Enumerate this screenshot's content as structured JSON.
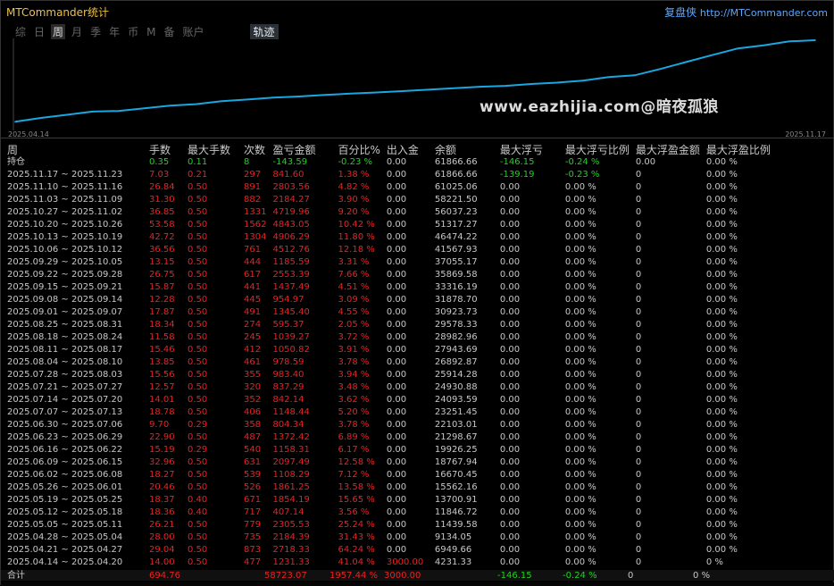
{
  "app": {
    "title": "MTCommander统计",
    "brand": "复盘侠",
    "url": "http://MTCommander.com"
  },
  "tabs": [
    {
      "label": "综",
      "active": false
    },
    {
      "label": "日",
      "active": false
    },
    {
      "label": "周",
      "active": true
    },
    {
      "label": "月",
      "active": false
    },
    {
      "label": "季",
      "active": false
    },
    {
      "label": "年",
      "active": false
    },
    {
      "label": "币",
      "active": false
    },
    {
      "label": "M",
      "active": false
    },
    {
      "label": "备",
      "active": false
    },
    {
      "label": "账户",
      "active": false
    }
  ],
  "track_tab": "轨迹",
  "watermark": "www.eazhijia.com@暗夜孤狼",
  "chart_data": {
    "type": "line",
    "x_start_label": "2025.04.14",
    "x_end_label": "2025.11.17",
    "y": [
      4231.33,
      6949.66,
      9134.05,
      11439.58,
      11846.72,
      13700.91,
      15562.16,
      16670.45,
      18767.94,
      19926.25,
      21298.67,
      22103.01,
      23251.45,
      24093.59,
      24930.88,
      25914.28,
      26892.87,
      27943.69,
      28982.96,
      29578.33,
      30923.73,
      31878.7,
      33316.19,
      35869.58,
      37055.17,
      41567.93,
      46474.22,
      51317.27,
      56037.23,
      58221.5,
      61025.06,
      61866.66
    ],
    "color": "#1aa6e0"
  },
  "table": {
    "headers": [
      "周",
      "手数",
      "最大手数",
      "次数",
      "盈亏金额",
      "百分比%",
      "出入金",
      "余额",
      "最大浮亏",
      "最大浮亏比例",
      "最大浮盈金额",
      "最大浮盈比例"
    ],
    "position_row": [
      "持仓",
      "0.35",
      "0.11",
      "8",
      "-143.59",
      "-0.23 %",
      "0.00",
      "61866.66",
      "-146.15",
      "-0.24 %",
      "0.00",
      "0.00 %"
    ],
    "rows": [
      [
        "2025.11.17 ~ 2025.11.23",
        "7.03",
        "0.21",
        "297",
        "841.60",
        "1.38 %",
        "0.00",
        "61866.66",
        "-139.19",
        "-0.23 %",
        "0",
        "0.00 %"
      ],
      [
        "2025.11.10 ~ 2025.11.16",
        "26.84",
        "0.50",
        "891",
        "2803.56",
        "4.82 %",
        "0.00",
        "61025.06",
        "0.00",
        "0.00 %",
        "0",
        "0.00 %"
      ],
      [
        "2025.11.03 ~ 2025.11.09",
        "31.30",
        "0.50",
        "882",
        "2184.27",
        "3.90 %",
        "0.00",
        "58221.50",
        "0.00",
        "0.00 %",
        "0",
        "0.00 %"
      ],
      [
        "2025.10.27 ~ 2025.11.02",
        "36.85",
        "0.50",
        "1331",
        "4719.96",
        "9.20 %",
        "0.00",
        "56037.23",
        "0.00",
        "0.00 %",
        "0",
        "0.00 %"
      ],
      [
        "2025.10.20 ~ 2025.10.26",
        "53.58",
        "0.50",
        "1562",
        "4843.05",
        "10.42 %",
        "0.00",
        "51317.27",
        "0.00",
        "0.00 %",
        "0",
        "0.00 %"
      ],
      [
        "2025.10.13 ~ 2025.10.19",
        "42.72",
        "0.50",
        "1304",
        "4906.29",
        "11.80 %",
        "0.00",
        "46474.22",
        "0.00",
        "0.00 %",
        "0",
        "0.00 %"
      ],
      [
        "2025.10.06 ~ 2025.10.12",
        "36.56",
        "0.50",
        "761",
        "4512.76",
        "12.18 %",
        "0.00",
        "41567.93",
        "0.00",
        "0.00 %",
        "0",
        "0.00 %"
      ],
      [
        "2025.09.29 ~ 2025.10.05",
        "13.15",
        "0.50",
        "444",
        "1185.59",
        "3.31 %",
        "0.00",
        "37055.17",
        "0.00",
        "0.00 %",
        "0",
        "0.00 %"
      ],
      [
        "2025.09.22 ~ 2025.09.28",
        "26.75",
        "0.50",
        "617",
        "2553.39",
        "7.66 %",
        "0.00",
        "35869.58",
        "0.00",
        "0.00 %",
        "0",
        "0.00 %"
      ],
      [
        "2025.09.15 ~ 2025.09.21",
        "15.87",
        "0.50",
        "441",
        "1437.49",
        "4.51 %",
        "0.00",
        "33316.19",
        "0.00",
        "0.00 %",
        "0",
        "0.00 %"
      ],
      [
        "2025.09.08 ~ 2025.09.14",
        "12.28",
        "0.50",
        "445",
        "954.97",
        "3.09 %",
        "0.00",
        "31878.70",
        "0.00",
        "0.00 %",
        "0",
        "0.00 %"
      ],
      [
        "2025.09.01 ~ 2025.09.07",
        "17.87",
        "0.50",
        "491",
        "1345.40",
        "4.55 %",
        "0.00",
        "30923.73",
        "0.00",
        "0.00 %",
        "0",
        "0.00 %"
      ],
      [
        "2025.08.25 ~ 2025.08.31",
        "18.34",
        "0.50",
        "274",
        "595.37",
        "2.05 %",
        "0.00",
        "29578.33",
        "0.00",
        "0.00 %",
        "0",
        "0.00 %"
      ],
      [
        "2025.08.18 ~ 2025.08.24",
        "11.58",
        "0.50",
        "245",
        "1039.27",
        "3.72 %",
        "0.00",
        "28982.96",
        "0.00",
        "0.00 %",
        "0",
        "0.00 %"
      ],
      [
        "2025.08.11 ~ 2025.08.17",
        "15.46",
        "0.50",
        "412",
        "1050.82",
        "3.91 %",
        "0.00",
        "27943.69",
        "0.00",
        "0.00 %",
        "0",
        "0.00 %"
      ],
      [
        "2025.08.04 ~ 2025.08.10",
        "13.85",
        "0.50",
        "461",
        "978.59",
        "3.78 %",
        "0.00",
        "26892.87",
        "0.00",
        "0.00 %",
        "0",
        "0.00 %"
      ],
      [
        "2025.07.28 ~ 2025.08.03",
        "15.56",
        "0.50",
        "355",
        "983.40",
        "3.94 %",
        "0.00",
        "25914.28",
        "0.00",
        "0.00 %",
        "0",
        "0.00 %"
      ],
      [
        "2025.07.21 ~ 2025.07.27",
        "12.57",
        "0.50",
        "320",
        "837.29",
        "3.48 %",
        "0.00",
        "24930.88",
        "0.00",
        "0.00 %",
        "0",
        "0.00 %"
      ],
      [
        "2025.07.14 ~ 2025.07.20",
        "14.01",
        "0.50",
        "352",
        "842.14",
        "3.62 %",
        "0.00",
        "24093.59",
        "0.00",
        "0.00 %",
        "0",
        "0.00 %"
      ],
      [
        "2025.07.07 ~ 2025.07.13",
        "18.78",
        "0.50",
        "406",
        "1148.44",
        "5.20 %",
        "0.00",
        "23251.45",
        "0.00",
        "0.00 %",
        "0",
        "0.00 %"
      ],
      [
        "2025.06.30 ~ 2025.07.06",
        "9.70",
        "0.29",
        "358",
        "804.34",
        "3.78 %",
        "0.00",
        "22103.01",
        "0.00",
        "0.00 %",
        "0",
        "0.00 %"
      ],
      [
        "2025.06.23 ~ 2025.06.29",
        "22.90",
        "0.50",
        "487",
        "1372.42",
        "6.89 %",
        "0.00",
        "21298.67",
        "0.00",
        "0.00 %",
        "0",
        "0.00 %"
      ],
      [
        "2025.06.16 ~ 2025.06.22",
        "15.19",
        "0.29",
        "540",
        "1158.31",
        "6.17 %",
        "0.00",
        "19926.25",
        "0.00",
        "0.00 %",
        "0",
        "0.00 %"
      ],
      [
        "2025.06.09 ~ 2025.06.15",
        "32.96",
        "0.50",
        "631",
        "2097.49",
        "12.58 %",
        "0.00",
        "18767.94",
        "0.00",
        "0.00 %",
        "0",
        "0.00 %"
      ],
      [
        "2025.06.02 ~ 2025.06.08",
        "18.27",
        "0.50",
        "539",
        "1108.29",
        "7.12 %",
        "0.00",
        "16670.45",
        "0.00",
        "0.00 %",
        "0",
        "0.00 %"
      ],
      [
        "2025.05.26 ~ 2025.06.01",
        "20.46",
        "0.50",
        "526",
        "1861.25",
        "13.58 %",
        "0.00",
        "15562.16",
        "0.00",
        "0.00 %",
        "0",
        "0.00 %"
      ],
      [
        "2025.05.19 ~ 2025.05.25",
        "18.37",
        "0.40",
        "671",
        "1854.19",
        "15.65 %",
        "0.00",
        "13700.91",
        "0.00",
        "0.00 %",
        "0",
        "0.00 %"
      ],
      [
        "2025.05.12 ~ 2025.05.18",
        "18.36",
        "0.40",
        "717",
        "407.14",
        "3.56 %",
        "0.00",
        "11846.72",
        "0.00",
        "0.00 %",
        "0",
        "0.00 %"
      ],
      [
        "2025.05.05 ~ 2025.05.11",
        "26.21",
        "0.50",
        "779",
        "2305.53",
        "25.24 %",
        "0.00",
        "11439.58",
        "0.00",
        "0.00 %",
        "0",
        "0.00 %"
      ],
      [
        "2025.04.28 ~ 2025.05.04",
        "28.00",
        "0.50",
        "735",
        "2184.39",
        "31.43 %",
        "0.00",
        "9134.05",
        "0.00",
        "0.00 %",
        "0",
        "0.00 %"
      ],
      [
        "2025.04.21 ~ 2025.04.27",
        "29.04",
        "0.50",
        "873",
        "2718.33",
        "64.24 %",
        "0.00",
        "6949.66",
        "0.00",
        "0.00 %",
        "0",
        "0.00 %"
      ],
      [
        "2025.04.14 ~ 2025.04.20",
        "14.00",
        "0.50",
        "477",
        "1231.33",
        "41.04 %",
        "3000.00",
        "4231.33",
        "0.00",
        "0.00 %",
        "0",
        "0 %"
      ]
    ],
    "total_row": [
      "合计",
      "694.76",
      "",
      "",
      "58723.07",
      "1957.44 %",
      "3000.00",
      "",
      "-146.15",
      "-0.24 %",
      "0",
      "0 %"
    ]
  },
  "colors": {
    "profit": "#ee2020",
    "loss": "#22d022",
    "line": "#1aa6e0",
    "title": "#f0c040",
    "brand": "#5aa8ff"
  }
}
